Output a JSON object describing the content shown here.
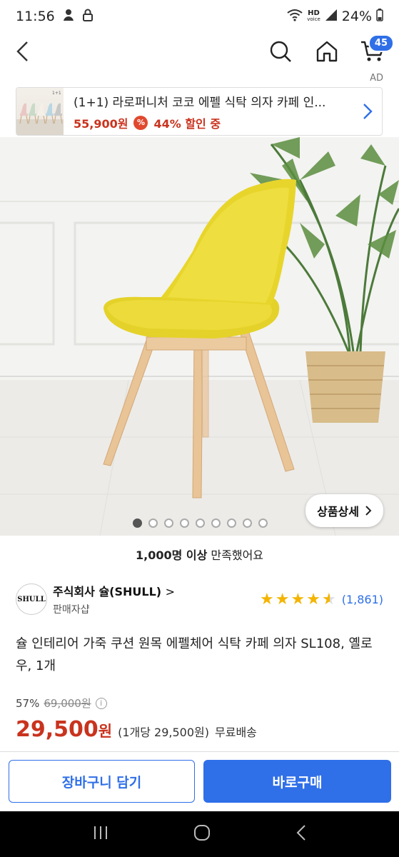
{
  "status": {
    "time": "11:56",
    "hd_top": "HD",
    "hd_bottom": "voice",
    "battery": "24%"
  },
  "header": {
    "cart_count": "45"
  },
  "ad": {
    "label": "AD",
    "title": "(1+1) 라로퍼니처 코코 에펠 식탁 의자 카페 인...",
    "thumb_caption": "1+1",
    "price": "55,900원",
    "discount": "44% 할인 중"
  },
  "gallery": {
    "detail_button": "상품상세",
    "dot_count": 9,
    "active_index": 0
  },
  "satisfaction": {
    "count": "1,000명 이상",
    "suffix": " 만족했어요"
  },
  "seller": {
    "logo_text": "SHULL",
    "name": "주식회사 슐(SHULL)",
    "chevron": ">",
    "type": "판매자샵"
  },
  "rating": {
    "stars": 4.5,
    "count": "(1,861)"
  },
  "product": {
    "title": "슐 인테리어 가죽 쿠션 원목 에펠체어 식탁 카페 의자 SL108, 옐로우, 1개"
  },
  "price": {
    "discount_rate": "57%",
    "original": "69,000원",
    "info_icon": "i",
    "sale": "29,500",
    "sale_unit": "원",
    "per_unit": "(1개당 29,500원)",
    "shipping": "무료배송"
  },
  "actions": {
    "cart_label": "장바구니 담기",
    "buy_label": "바로구매"
  }
}
